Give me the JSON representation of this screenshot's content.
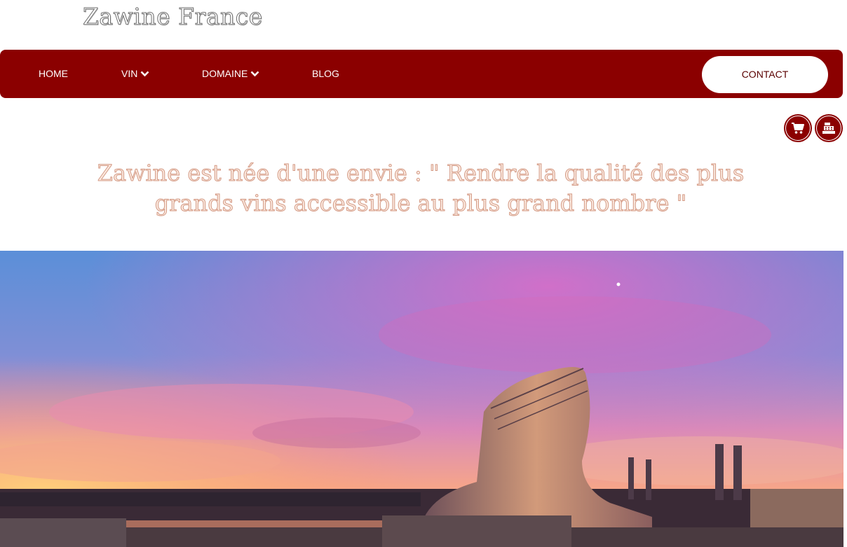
{
  "brand": {
    "name": "Zawine France"
  },
  "nav": {
    "items": [
      {
        "label": "HOME",
        "has_dropdown": false
      },
      {
        "label": "VIN",
        "has_dropdown": true
      },
      {
        "label": "DOMAINE",
        "has_dropdown": true
      },
      {
        "label": "BLOG",
        "has_dropdown": false
      }
    ],
    "contact_label": "CONTACT"
  },
  "tools": {
    "cart_icon": "shopping-cart-icon",
    "register_icon": "cash-register-icon"
  },
  "tagline": {
    "line1": "Zawine est née d'une envie : \" Rendre la qualité des plus",
    "line2": "grands vins accessible au plus grand nombre \""
  },
  "hero": {
    "subject": "cite-du-vin-sunset-photo"
  },
  "colors": {
    "brand_red": "#8b0000",
    "tagline_color": "#d49b86",
    "white": "#ffffff"
  }
}
